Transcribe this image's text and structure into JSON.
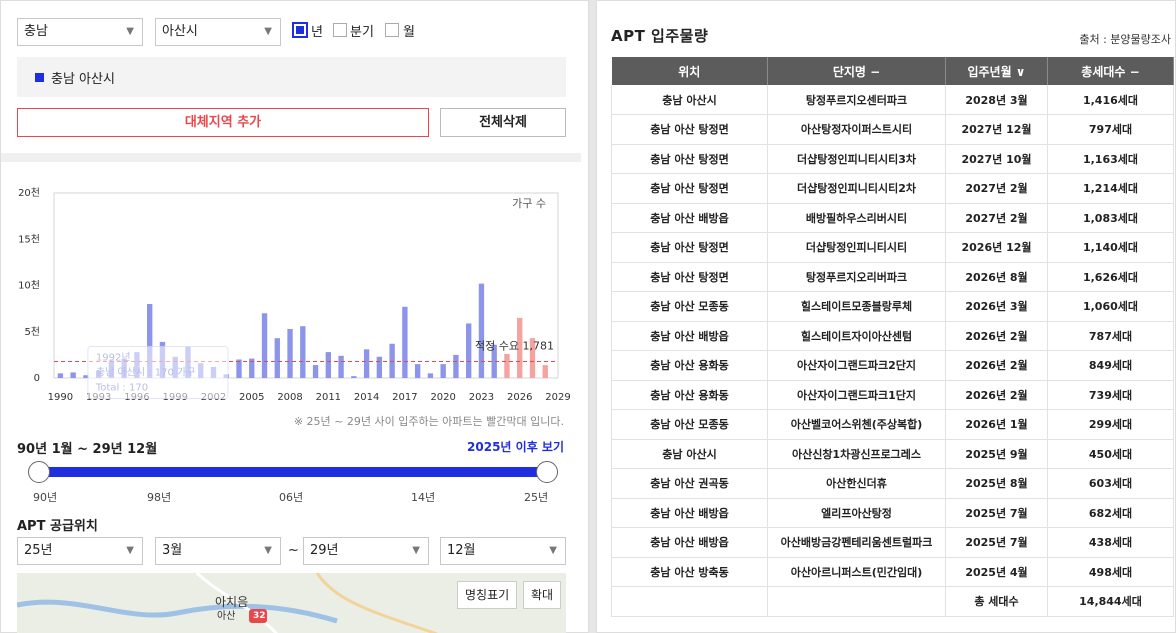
{
  "filters": {
    "province": "충남",
    "city": "아산시",
    "periods": [
      {
        "label": "년",
        "checked": true
      },
      {
        "label": "분기",
        "checked": false
      },
      {
        "label": "월",
        "checked": false
      }
    ],
    "selected_region": "충남 아산시",
    "add_region_label": "대체지역 추가",
    "delete_all_label": "전체삭제"
  },
  "chart_data": {
    "type": "bar",
    "unit_label": "가구 수",
    "y_ticks": [
      "20천",
      "15천",
      "10천",
      "5천",
      "0"
    ],
    "ylim": [
      0,
      20000
    ],
    "x_tick_labels": [
      "1990",
      "1993",
      "1996",
      "1999",
      "2002",
      "2005",
      "2008",
      "2011",
      "2014",
      "2017",
      "2020",
      "2023",
      "2026",
      "2029"
    ],
    "x": [
      1990,
      1991,
      1992,
      1993,
      1994,
      1995,
      1996,
      1997,
      1998,
      1999,
      2000,
      2001,
      2002,
      2003,
      2004,
      2005,
      2006,
      2007,
      2008,
      2009,
      2010,
      2011,
      2012,
      2013,
      2014,
      2015,
      2016,
      2017,
      2018,
      2019,
      2020,
      2021,
      2022,
      2023,
      2024,
      2025,
      2026,
      2027,
      2028
    ],
    "values": [
      500,
      600,
      300,
      800,
      1900,
      2100,
      2800,
      8000,
      3900,
      2300,
      3400,
      1600,
      1200,
      400,
      2000,
      2100,
      7000,
      4300,
      5300,
      5600,
      1400,
      2800,
      2400,
      200,
      3100,
      2300,
      3700,
      7700,
      1500,
      500,
      1500,
      2500,
      5900,
      10200,
      3600,
      2600,
      6500,
      4300,
      1400
    ],
    "colors": {
      "past": "#8c95ea",
      "future": "#f4a3a0",
      "threshold": "#e8474b"
    },
    "threshold_label": "적정 수요 1,781",
    "threshold_value": 1781,
    "tooltip": {
      "year": "1992년",
      "series": "충남 아산시 : 170 가구",
      "total": "Total : 170"
    }
  },
  "chart_note": "※ 25년 ~ 29년 사이 입주하는 아파트는 빨간막대 입니다.",
  "range": {
    "label": "90년 1월 ~ 29년 12월",
    "after_link": "2025년 이후 보기",
    "ticks": [
      "90년",
      "98년",
      "06년",
      "14년",
      "25년"
    ]
  },
  "supply": {
    "title": "APT 공급위치",
    "from_year": "25년",
    "from_month": "3월",
    "tilde": "~",
    "to_year": "29년",
    "to_month": "12월",
    "map_name_toggle": "명칭표기",
    "map_zoom": "확대",
    "map_place_label": "아산",
    "map_place_label2": "아치음",
    "map_route": "32"
  },
  "table": {
    "title": "APT 입주물량",
    "source": "출처 : 분양물량조사",
    "headers": [
      "위치",
      "단지명 −",
      "입주년월 ∨",
      "총세대수 −"
    ],
    "rows": [
      [
        "충남 아산시",
        "탕정푸르지오센터파크",
        "2028년 3월",
        "1,416세대"
      ],
      [
        "충남 아산 탕정면",
        "아산탕정자이퍼스트시티",
        "2027년 12월",
        "797세대"
      ],
      [
        "충남 아산 탕정면",
        "더샵탕정인피니티시티3차",
        "2027년 10월",
        "1,163세대"
      ],
      [
        "충남 아산 탕정면",
        "더샵탕정인피니티시티2차",
        "2027년 2월",
        "1,214세대"
      ],
      [
        "충남 아산 배방읍",
        "배방필하우스리버시티",
        "2027년 2월",
        "1,083세대"
      ],
      [
        "충남 아산 탕정면",
        "더샵탕정인피니티시티",
        "2026년 12월",
        "1,140세대"
      ],
      [
        "충남 아산 탕정면",
        "탕정푸르지오리버파크",
        "2026년 8월",
        "1,626세대"
      ],
      [
        "충남 아산 모종동",
        "힐스테이트모종블랑루체",
        "2026년 3월",
        "1,060세대"
      ],
      [
        "충남 아산 배방읍",
        "힐스테이트자이아산센텀",
        "2026년 2월",
        "787세대"
      ],
      [
        "충남 아산 용화동",
        "아산자이그랜드파크2단지",
        "2026년 2월",
        "849세대"
      ],
      [
        "충남 아산 용화동",
        "아산자이그랜드파크1단지",
        "2026년 2월",
        "739세대"
      ],
      [
        "충남 아산 모종동",
        "아산벨코어스위첸(주상복합)",
        "2026년 1월",
        "299세대"
      ],
      [
        "충남 아산시",
        "아산신창1차광신프로그레스",
        "2025년 9월",
        "450세대"
      ],
      [
        "충남 아산 권곡동",
        "아산한신더휴",
        "2025년 8월",
        "603세대"
      ],
      [
        "충남 아산 배방읍",
        "엘리프아산탕정",
        "2025년 7월",
        "682세대"
      ],
      [
        "충남 아산 배방읍",
        "아산배방금강펜테리움센트럴파크",
        "2025년 7월",
        "438세대"
      ],
      [
        "충남 아산 방축동",
        "아산아르니퍼스트(민간임대)",
        "2025년 4월",
        "498세대"
      ]
    ],
    "total_label": "총 세대수",
    "total_value": "14,844세대"
  }
}
